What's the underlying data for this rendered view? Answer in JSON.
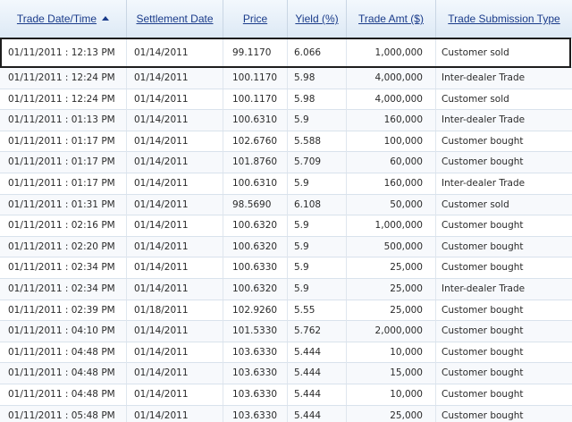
{
  "table": {
    "headers": {
      "trade_date_time": "Trade Date/Time",
      "settlement_date": "Settlement Date",
      "price": "Price",
      "yield": "Yield (%)",
      "trade_amt": "Trade Amt ($)",
      "trade_submission_type": "Trade Submission Type"
    },
    "sort": {
      "column": "trade_date_time",
      "direction": "ascending",
      "icon": "sort-ascending-icon"
    },
    "rows": [
      {
        "date": "01/11/2011 : 12:13 PM",
        "settle": "01/14/2011",
        "price": "99.1170",
        "yield": "6.066",
        "amt": "1,000,000",
        "type": "Customer sold",
        "selected": true
      },
      {
        "date": "01/11/2011 : 12:24 PM",
        "settle": "01/14/2011",
        "price": "100.1170",
        "yield": "5.98",
        "amt": "4,000,000",
        "type": "Inter-dealer Trade"
      },
      {
        "date": "01/11/2011 : 12:24 PM",
        "settle": "01/14/2011",
        "price": "100.1170",
        "yield": "5.98",
        "amt": "4,000,000",
        "type": "Customer sold"
      },
      {
        "date": "01/11/2011 : 01:13 PM",
        "settle": "01/14/2011",
        "price": "100.6310",
        "yield": "5.9",
        "amt": "160,000",
        "type": "Inter-dealer Trade"
      },
      {
        "date": "01/11/2011 : 01:17 PM",
        "settle": "01/14/2011",
        "price": "102.6760",
        "yield": "5.588",
        "amt": "100,000",
        "type": "Customer bought"
      },
      {
        "date": "01/11/2011 : 01:17 PM",
        "settle": "01/14/2011",
        "price": "101.8760",
        "yield": "5.709",
        "amt": "60,000",
        "type": "Customer bought"
      },
      {
        "date": "01/11/2011 : 01:17 PM",
        "settle": "01/14/2011",
        "price": "100.6310",
        "yield": "5.9",
        "amt": "160,000",
        "type": "Inter-dealer Trade"
      },
      {
        "date": "01/11/2011 : 01:31 PM",
        "settle": "01/14/2011",
        "price": "98.5690",
        "yield": "6.108",
        "amt": "50,000",
        "type": "Customer sold"
      },
      {
        "date": "01/11/2011 : 02:16 PM",
        "settle": "01/14/2011",
        "price": "100.6320",
        "yield": "5.9",
        "amt": "1,000,000",
        "type": "Customer bought"
      },
      {
        "date": "01/11/2011 : 02:20 PM",
        "settle": "01/14/2011",
        "price": "100.6320",
        "yield": "5.9",
        "amt": "500,000",
        "type": "Customer bought"
      },
      {
        "date": "01/11/2011 : 02:34 PM",
        "settle": "01/14/2011",
        "price": "100.6330",
        "yield": "5.9",
        "amt": "25,000",
        "type": "Customer bought"
      },
      {
        "date": "01/11/2011 : 02:34 PM",
        "settle": "01/14/2011",
        "price": "100.6320",
        "yield": "5.9",
        "amt": "25,000",
        "type": "Inter-dealer Trade"
      },
      {
        "date": "01/11/2011 : 02:39 PM",
        "settle": "01/18/2011",
        "price": "102.9260",
        "yield": "5.55",
        "amt": "25,000",
        "type": "Customer bought"
      },
      {
        "date": "01/11/2011 : 04:10 PM",
        "settle": "01/14/2011",
        "price": "101.5330",
        "yield": "5.762",
        "amt": "2,000,000",
        "type": "Customer bought"
      },
      {
        "date": "01/11/2011 : 04:48 PM",
        "settle": "01/14/2011",
        "price": "103.6330",
        "yield": "5.444",
        "amt": "10,000",
        "type": "Customer bought"
      },
      {
        "date": "01/11/2011 : 04:48 PM",
        "settle": "01/14/2011",
        "price": "103.6330",
        "yield": "5.444",
        "amt": "15,000",
        "type": "Customer bought"
      },
      {
        "date": "01/11/2011 : 04:48 PM",
        "settle": "01/14/2011",
        "price": "103.6330",
        "yield": "5.444",
        "amt": "10,000",
        "type": "Customer bought"
      },
      {
        "date": "01/11/2011 : 05:48 PM",
        "settle": "01/14/2011",
        "price": "103.6330",
        "yield": "5.444",
        "amt": "25,000",
        "type": "Customer bought"
      }
    ]
  }
}
